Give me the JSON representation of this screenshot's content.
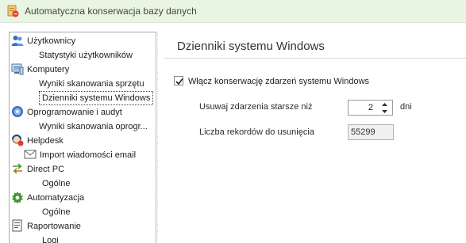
{
  "window": {
    "title": "Automatyczna konserwacja bazy danych",
    "icon": "database-maintenance-icon"
  },
  "tree": {
    "users": {
      "label": "Użytkownicy",
      "icon": "users-icon"
    },
    "user_stats": {
      "label": "Statystyki użytkowników"
    },
    "computers": {
      "label": "Komputery",
      "icon": "computer-icon"
    },
    "hw_scan": {
      "label": "Wyniki skanowania sprzętu"
    },
    "win_logs": {
      "label": "Dzienniki systemu Windows",
      "selected": true
    },
    "software": {
      "label": "Oprogramowanie i audyt",
      "icon": "disc-icon"
    },
    "sw_scan": {
      "label": "Wyniki skanowania oprogr..."
    },
    "helpdesk": {
      "label": "Helpdesk",
      "icon": "helpdesk-icon"
    },
    "import_mail": {
      "label": "Import wiadomości email",
      "icon": "envelope-icon"
    },
    "direct_pc": {
      "label": "Direct PC",
      "icon": "arrows-icon"
    },
    "direct_general": {
      "label": "Ogólne"
    },
    "automation": {
      "label": "Automatyzacja",
      "icon": "gear-icon"
    },
    "automation_general": {
      "label": "Ogólne"
    },
    "reports": {
      "label": "Raportowanie",
      "icon": "report-icon"
    },
    "logs": {
      "label": "Logi"
    }
  },
  "settings": {
    "section_title": "Dzienniki systemu Windows",
    "enable_label": "Włącz konserwację zdarzeń systemu Windows",
    "enable_checked": true,
    "older_than_label": "Usuwaj zdarzenia starsze niż",
    "older_than_value": "2",
    "older_than_unit": "dni",
    "records_label": "Liczba rekordów do usunięcia",
    "records_value": "55299"
  }
}
